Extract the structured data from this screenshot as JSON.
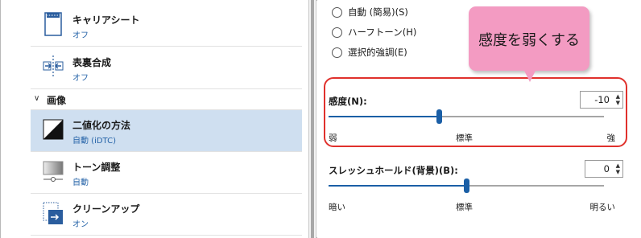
{
  "left_panel": {
    "items": [
      {
        "title": "キャリアシート",
        "sub": "オフ",
        "icon": "carrier-sheet-icon"
      },
      {
        "title": "表裏合成",
        "sub": "オフ",
        "icon": "merge-sides-icon"
      }
    ],
    "section": {
      "label": "画像",
      "icon": "chevron-down-icon"
    },
    "image_items": [
      {
        "title": "二値化の方法",
        "sub": "自動 (iDTC)",
        "icon": "binarization-icon",
        "selected": true
      },
      {
        "title": "トーン調整",
        "sub": "自動",
        "icon": "tone-adjust-icon"
      },
      {
        "title": "クリーンアップ",
        "sub": "オン",
        "icon": "cleanup-icon"
      }
    ]
  },
  "right_panel": {
    "radios": [
      {
        "label": "自動 (簡易)(S)"
      },
      {
        "label": "ハーフトーン(H)"
      },
      {
        "label": "選択的強調(E)"
      }
    ],
    "sensitivity": {
      "label": "感度(N):",
      "value": "-10",
      "slider_fraction": 0.4,
      "ticks": {
        "left": "弱",
        "center": "標準",
        "right": "強"
      }
    },
    "threshold": {
      "label": "スレッシュホールド(背景)(B):",
      "value": "0",
      "slider_fraction": 0.5,
      "ticks": {
        "left": "暗い",
        "center": "標準",
        "right": "明るい"
      }
    },
    "callout": {
      "text": "感度を弱くする"
    }
  },
  "colors": {
    "accent": "#1b5fa6",
    "selected_row": "#cfdff0",
    "highlight_border": "#e0312c",
    "callout_bg": "#f39bc2",
    "sub_text": "#2563a8"
  }
}
